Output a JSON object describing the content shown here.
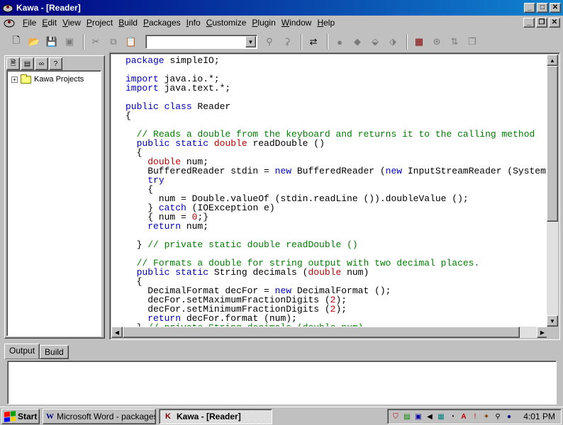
{
  "window": {
    "title": "Kawa - [Reader]"
  },
  "menu": [
    "File",
    "Edit",
    "View",
    "Project",
    "Build",
    "Packages",
    "Info",
    "Customize",
    "Plugin",
    "Window",
    "Help"
  ],
  "toolbar": {
    "combo_value": ""
  },
  "project_tree": {
    "root_label": "Kawa Projects"
  },
  "editor": {
    "lines": [
      [
        [
          "kw",
          "package"
        ],
        [
          "",
          " simpleIO;"
        ]
      ],
      [],
      [
        [
          "kw",
          "import"
        ],
        [
          "",
          " java.io.*;"
        ]
      ],
      [
        [
          "kw",
          "import"
        ],
        [
          "",
          " java.text.*;"
        ]
      ],
      [],
      [
        [
          "kw",
          "public class"
        ],
        [
          "",
          " Reader"
        ]
      ],
      [
        [
          "",
          "{"
        ]
      ],
      [],
      [
        [
          "",
          "  "
        ],
        [
          "cm",
          "// Reads a double from the keyboard and returns it to the calling method"
        ]
      ],
      [
        [
          "",
          "  "
        ],
        [
          "kw",
          "public static"
        ],
        [
          "",
          " "
        ],
        [
          "ty",
          "double"
        ],
        [
          "",
          " readDouble ()"
        ]
      ],
      [
        [
          "",
          "  {"
        ]
      ],
      [
        [
          "",
          "    "
        ],
        [
          "ty",
          "double"
        ],
        [
          "",
          " num;"
        ]
      ],
      [
        [
          "",
          "    BufferedReader stdin = "
        ],
        [
          "kw",
          "new"
        ],
        [
          "",
          " BufferedReader ("
        ],
        [
          "kw",
          "new"
        ],
        [
          "",
          " InputStreamReader (System.in));"
        ]
      ],
      [
        [
          "",
          "    "
        ],
        [
          "kw",
          "try"
        ]
      ],
      [
        [
          "",
          "    {"
        ]
      ],
      [
        [
          "",
          "      num = Double.valueOf (stdin.readLine ()).doubleValue ();"
        ]
      ],
      [
        [
          "",
          "    } "
        ],
        [
          "kw",
          "catch"
        ],
        [
          "",
          " (IOException e)"
        ]
      ],
      [
        [
          "",
          "    { num = "
        ],
        [
          "num",
          "0"
        ],
        [
          "",
          ";}"
        ]
      ],
      [
        [
          "",
          "    "
        ],
        [
          "kw",
          "return"
        ],
        [
          "",
          " num;"
        ]
      ],
      [],
      [
        [
          "",
          "  } "
        ],
        [
          "cm",
          "// private static double readDouble ()"
        ]
      ],
      [],
      [
        [
          "",
          "  "
        ],
        [
          "cm",
          "// Formats a double for string output with two decimal places."
        ]
      ],
      [
        [
          "",
          "  "
        ],
        [
          "kw",
          "public static"
        ],
        [
          "",
          " String decimals ("
        ],
        [
          "ty",
          "double"
        ],
        [
          "",
          " num)"
        ]
      ],
      [
        [
          "",
          "  {"
        ]
      ],
      [
        [
          "",
          "    DecimalFormat decFor = "
        ],
        [
          "kw",
          "new"
        ],
        [
          "",
          " DecimalFormat ();"
        ]
      ],
      [
        [
          "",
          "    decFor.setMaximumFractionDigits ("
        ],
        [
          "num",
          "2"
        ],
        [
          "",
          ");"
        ]
      ],
      [
        [
          "",
          "    decFor.setMinimumFractionDigits ("
        ],
        [
          "num",
          "2"
        ],
        [
          "",
          ");"
        ]
      ],
      [
        [
          "",
          "    "
        ],
        [
          "kw",
          "return"
        ],
        [
          "",
          " decFor.format (num);"
        ]
      ],
      [
        [
          "",
          "  } "
        ],
        [
          "cm",
          "// private String decimals (double num)"
        ]
      ]
    ]
  },
  "output_tabs": [
    "Output",
    "Build"
  ],
  "taskbar": {
    "start_label": "Start",
    "tasks": [
      {
        "label": "Microsoft Word - packages",
        "icon": "W"
      },
      {
        "label": "Kawa - [Reader]",
        "icon": "K"
      }
    ],
    "clock": "4:01 PM"
  },
  "colors": {
    "keyword": "#0000c0",
    "type": "#c00000",
    "comment": "#008000",
    "titlebar": "#000080"
  }
}
